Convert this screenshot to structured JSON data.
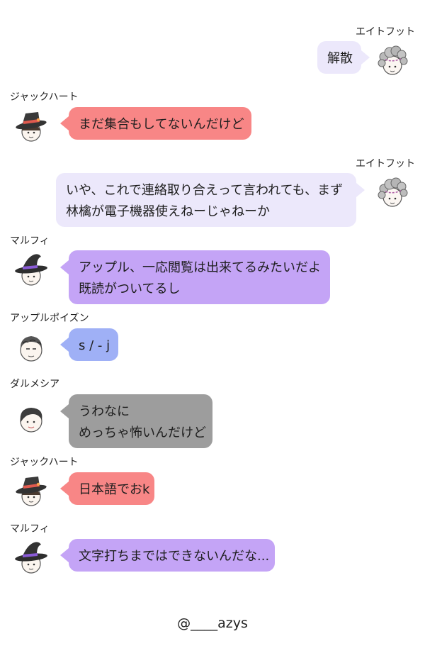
{
  "colors": {
    "lavender": "#ece8fb",
    "red": "#f88686",
    "purple": "#c4a4f6",
    "blue": "#9fb0f6",
    "gray": "#9d9d9d"
  },
  "messages": [
    {
      "sender": "エイトフット",
      "side": "right",
      "color": "lavender",
      "avatar": "eightfoot-avatar",
      "lines": [
        "解散"
      ]
    },
    {
      "sender": "ジャックハート",
      "side": "left",
      "color": "red",
      "avatar": "jackheart-avatar",
      "lines": [
        "まだ集合もしてないんだけど"
      ]
    },
    {
      "sender": "エイトフット",
      "side": "right",
      "color": "lavender",
      "avatar": "eightfoot-avatar",
      "lines": [
        "いや、これで連絡取り合えって言われても、まず",
        "林檎が電子機器使えねーじゃねーか"
      ]
    },
    {
      "sender": "マルフィ",
      "side": "left",
      "color": "purple",
      "avatar": "malfi-avatar",
      "lines": [
        "アップル、一応閲覧は出来てるみたいだよ",
        "既読がついてるし"
      ]
    },
    {
      "sender": "アップルポイズン",
      "side": "left",
      "color": "blue",
      "avatar": "applepoison-avatar",
      "lines": [
        "s / - j"
      ]
    },
    {
      "sender": "ダルメシア",
      "side": "left",
      "color": "gray",
      "avatar": "dalmesia-avatar",
      "lines": [
        "うわなに",
        "めっちゃ怖いんだけど"
      ]
    },
    {
      "sender": "ジャックハート",
      "side": "left",
      "color": "red",
      "avatar": "jackheart-avatar",
      "lines": [
        "日本語でおk"
      ]
    },
    {
      "sender": "マルフィ",
      "side": "left",
      "color": "purple",
      "avatar": "malfi-avatar",
      "lines": [
        "文字打ちまではできないんだな..."
      ]
    }
  ],
  "footer": "@____azys"
}
